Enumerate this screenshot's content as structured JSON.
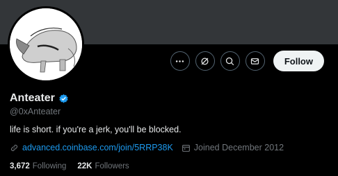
{
  "profile": {
    "name": "Anteater",
    "handle": "@0xAnteater",
    "bio": "life is short. if you're a jerk, you'll be blocked.",
    "link": "advanced.coinbase.com/join/5RRP38K",
    "joined": "Joined December 2012",
    "following_count": "3,672",
    "following_label": "Following",
    "followers_count": "22K",
    "followers_label": "Followers"
  },
  "actions": {
    "follow_label": "Follow",
    "icons": [
      "more-icon",
      "grok-icon",
      "search-icon",
      "message-icon"
    ]
  },
  "colors": {
    "background": "#000000",
    "banner": "#333639",
    "accent": "#1d9bf0",
    "muted": "#71767b"
  }
}
